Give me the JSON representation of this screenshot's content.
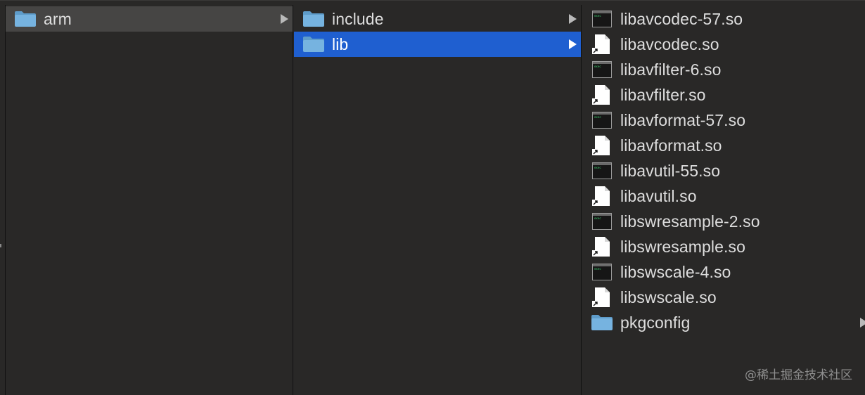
{
  "columns": [
    {
      "items": [
        {
          "label": "arm",
          "icon": "folder-icon",
          "chevron": true,
          "selected": "inactive"
        }
      ]
    },
    {
      "items": [
        {
          "label": "include",
          "icon": "folder-icon",
          "chevron": true,
          "selected": "none"
        },
        {
          "label": "lib",
          "icon": "folder-icon",
          "chevron": true,
          "selected": "active"
        }
      ]
    },
    {
      "items": [
        {
          "label": "libavcodec-57.so",
          "icon": "exec-file-icon"
        },
        {
          "label": "libavcodec.so",
          "icon": "alias-file-icon"
        },
        {
          "label": "libavfilter-6.so",
          "icon": "exec-file-icon"
        },
        {
          "label": "libavfilter.so",
          "icon": "alias-file-icon"
        },
        {
          "label": "libavformat-57.so",
          "icon": "exec-file-icon"
        },
        {
          "label": "libavformat.so",
          "icon": "alias-file-icon"
        },
        {
          "label": "libavutil-55.so",
          "icon": "exec-file-icon"
        },
        {
          "label": "libavutil.so",
          "icon": "alias-file-icon"
        },
        {
          "label": "libswresample-2.so",
          "icon": "exec-file-icon"
        },
        {
          "label": "libswresample.so",
          "icon": "alias-file-icon"
        },
        {
          "label": "libswscale-4.so",
          "icon": "exec-file-icon"
        },
        {
          "label": "libswscale.so",
          "icon": "alias-file-icon"
        },
        {
          "label": "pkgconfig",
          "icon": "folder-icon",
          "chevron": true
        }
      ]
    }
  ],
  "watermark": "@稀土掘金技术社区",
  "colors": {
    "background": "#292827",
    "selection_active": "#1f5fd0",
    "selection_inactive": "#464544",
    "folder": "#6aa9d8",
    "text": "#dedede"
  }
}
